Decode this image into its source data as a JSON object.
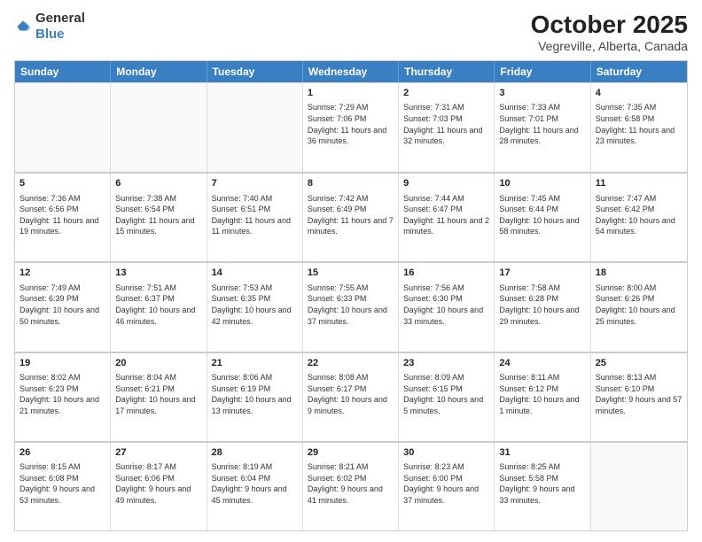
{
  "header": {
    "logo_general": "General",
    "logo_blue": "Blue",
    "month_title": "October 2025",
    "subtitle": "Vegreville, Alberta, Canada"
  },
  "days_of_week": [
    "Sunday",
    "Monday",
    "Tuesday",
    "Wednesday",
    "Thursday",
    "Friday",
    "Saturday"
  ],
  "weeks": [
    [
      {
        "day": "",
        "info": ""
      },
      {
        "day": "",
        "info": ""
      },
      {
        "day": "",
        "info": ""
      },
      {
        "day": "1",
        "info": "Sunrise: 7:29 AM\nSunset: 7:06 PM\nDaylight: 11 hours and 36 minutes."
      },
      {
        "day": "2",
        "info": "Sunrise: 7:31 AM\nSunset: 7:03 PM\nDaylight: 11 hours and 32 minutes."
      },
      {
        "day": "3",
        "info": "Sunrise: 7:33 AM\nSunset: 7:01 PM\nDaylight: 11 hours and 28 minutes."
      },
      {
        "day": "4",
        "info": "Sunrise: 7:35 AM\nSunset: 6:58 PM\nDaylight: 11 hours and 23 minutes."
      }
    ],
    [
      {
        "day": "5",
        "info": "Sunrise: 7:36 AM\nSunset: 6:56 PM\nDaylight: 11 hours and 19 minutes."
      },
      {
        "day": "6",
        "info": "Sunrise: 7:38 AM\nSunset: 6:54 PM\nDaylight: 11 hours and 15 minutes."
      },
      {
        "day": "7",
        "info": "Sunrise: 7:40 AM\nSunset: 6:51 PM\nDaylight: 11 hours and 11 minutes."
      },
      {
        "day": "8",
        "info": "Sunrise: 7:42 AM\nSunset: 6:49 PM\nDaylight: 11 hours and 7 minutes."
      },
      {
        "day": "9",
        "info": "Sunrise: 7:44 AM\nSunset: 6:47 PM\nDaylight: 11 hours and 2 minutes."
      },
      {
        "day": "10",
        "info": "Sunrise: 7:45 AM\nSunset: 6:44 PM\nDaylight: 10 hours and 58 minutes."
      },
      {
        "day": "11",
        "info": "Sunrise: 7:47 AM\nSunset: 6:42 PM\nDaylight: 10 hours and 54 minutes."
      }
    ],
    [
      {
        "day": "12",
        "info": "Sunrise: 7:49 AM\nSunset: 6:39 PM\nDaylight: 10 hours and 50 minutes."
      },
      {
        "day": "13",
        "info": "Sunrise: 7:51 AM\nSunset: 6:37 PM\nDaylight: 10 hours and 46 minutes."
      },
      {
        "day": "14",
        "info": "Sunrise: 7:53 AM\nSunset: 6:35 PM\nDaylight: 10 hours and 42 minutes."
      },
      {
        "day": "15",
        "info": "Sunrise: 7:55 AM\nSunset: 6:33 PM\nDaylight: 10 hours and 37 minutes."
      },
      {
        "day": "16",
        "info": "Sunrise: 7:56 AM\nSunset: 6:30 PM\nDaylight: 10 hours and 33 minutes."
      },
      {
        "day": "17",
        "info": "Sunrise: 7:58 AM\nSunset: 6:28 PM\nDaylight: 10 hours and 29 minutes."
      },
      {
        "day": "18",
        "info": "Sunrise: 8:00 AM\nSunset: 6:26 PM\nDaylight: 10 hours and 25 minutes."
      }
    ],
    [
      {
        "day": "19",
        "info": "Sunrise: 8:02 AM\nSunset: 6:23 PM\nDaylight: 10 hours and 21 minutes."
      },
      {
        "day": "20",
        "info": "Sunrise: 8:04 AM\nSunset: 6:21 PM\nDaylight: 10 hours and 17 minutes."
      },
      {
        "day": "21",
        "info": "Sunrise: 8:06 AM\nSunset: 6:19 PM\nDaylight: 10 hours and 13 minutes."
      },
      {
        "day": "22",
        "info": "Sunrise: 8:08 AM\nSunset: 6:17 PM\nDaylight: 10 hours and 9 minutes."
      },
      {
        "day": "23",
        "info": "Sunrise: 8:09 AM\nSunset: 6:15 PM\nDaylight: 10 hours and 5 minutes."
      },
      {
        "day": "24",
        "info": "Sunrise: 8:11 AM\nSunset: 6:12 PM\nDaylight: 10 hours and 1 minute."
      },
      {
        "day": "25",
        "info": "Sunrise: 8:13 AM\nSunset: 6:10 PM\nDaylight: 9 hours and 57 minutes."
      }
    ],
    [
      {
        "day": "26",
        "info": "Sunrise: 8:15 AM\nSunset: 6:08 PM\nDaylight: 9 hours and 53 minutes."
      },
      {
        "day": "27",
        "info": "Sunrise: 8:17 AM\nSunset: 6:06 PM\nDaylight: 9 hours and 49 minutes."
      },
      {
        "day": "28",
        "info": "Sunrise: 8:19 AM\nSunset: 6:04 PM\nDaylight: 9 hours and 45 minutes."
      },
      {
        "day": "29",
        "info": "Sunrise: 8:21 AM\nSunset: 6:02 PM\nDaylight: 9 hours and 41 minutes."
      },
      {
        "day": "30",
        "info": "Sunrise: 8:23 AM\nSunset: 6:00 PM\nDaylight: 9 hours and 37 minutes."
      },
      {
        "day": "31",
        "info": "Sunrise: 8:25 AM\nSunset: 5:58 PM\nDaylight: 9 hours and 33 minutes."
      },
      {
        "day": "",
        "info": ""
      }
    ]
  ]
}
